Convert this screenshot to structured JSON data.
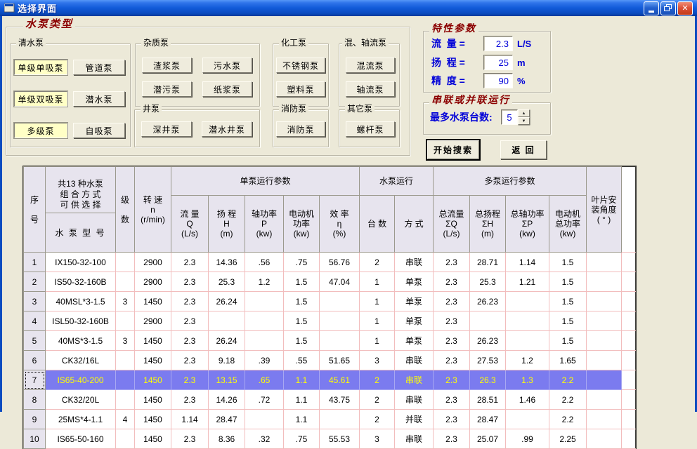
{
  "window": {
    "title": "选择界面",
    "caption_buttons": {
      "minimize": "minimize",
      "restore": "restore",
      "close": "close"
    }
  },
  "colors": {
    "titlebar_blue": "#115ad8",
    "form_background": "#ECE9D8",
    "group_title_red": "#8B0000",
    "label_blue": "#0000D8",
    "highlight_yellow": "#FFFFC6",
    "selection_bg": "#7B7BEF",
    "selection_text": "#FFFF00",
    "grid_line_pink": "#F2BDBD",
    "fixed_cell_bg": "#E7E4EE"
  },
  "pump_types": {
    "group_title": "水泵类型",
    "qingshui": {
      "label": "清水泵",
      "selected_buttons": [
        "单级单吸泵",
        "单级双吸泵",
        "多级泵"
      ],
      "normal_buttons": [
        "管道泵",
        "潜水泵",
        "自吸泵"
      ]
    },
    "zazhi": {
      "label": "杂质泵",
      "buttons": [
        "渣浆泵",
        "污水泵",
        "潜污泵",
        "纸浆泵"
      ]
    },
    "jing": {
      "label": "井泵",
      "buttons": [
        "深井泵",
        "潜水井泵"
      ]
    },
    "huagong": {
      "label": "化工泵",
      "buttons": [
        "不锈钢泵",
        "塑料泵"
      ]
    },
    "xiaofang": {
      "label": "消防泵",
      "buttons": [
        "消防泵"
      ]
    },
    "hunzhou": {
      "label": "混、轴流泵",
      "buttons": [
        "混流泵",
        "轴流泵"
      ]
    },
    "qita": {
      "label": "其它泵",
      "buttons": [
        "螺杆泵"
      ]
    }
  },
  "parameters": {
    "group_title": "特性参数",
    "flow_label": "流  量 =",
    "flow_value": "2.3",
    "flow_unit": "L/S",
    "head_label": "扬  程 =",
    "head_value": "25",
    "head_unit": "m",
    "precision_label": "精  度 =",
    "precision_value": "90",
    "precision_unit": "%"
  },
  "series_parallel": {
    "group_title": "串联或并联运行",
    "max_pumps_label": "最多水泵台数:",
    "max_pumps_value": "5",
    "spin_up": "▲",
    "spin_down": "▼"
  },
  "actions": {
    "search": "开始搜索",
    "back": "返  回"
  },
  "table": {
    "selected_row": 7,
    "header": {
      "seq": "序\n\n号",
      "combo_top": "共13 种水泵\n组 合 方 式\n可 供 选 择",
      "combo_bottom": "水 泵 型 号",
      "stages": "级\n\n数",
      "speed": "转  速\nn\n(r/min)",
      "single_group": "单泵运行参数",
      "run_group": "水泵运行",
      "multi_group": "多泵运行参数",
      "blade": "叶片安\n装角度\n( ° )",
      "single_cols": [
        "流 量\nQ\n(L/s)",
        "扬 程\nH\n(m)",
        "轴功率\nP\n(kw)",
        "电动机\n功率\n(kw)",
        "效 率\nη\n(%)"
      ],
      "run_cols": [
        "台  数",
        "方  式"
      ],
      "multi_cols": [
        "总流量\nΣQ\n(L/s)",
        "总扬程\nΣH\n(m)",
        "总轴功率\nΣP\n(kw)",
        "电动机\n总功率\n(kw)"
      ]
    },
    "rows": [
      [
        "1",
        "IX150-32-100",
        "",
        "2900",
        "2.3",
        "14.36",
        ".56",
        ".75",
        "56.76",
        "2",
        "串联",
        "2.3",
        "28.71",
        "1.14",
        "1.5",
        ""
      ],
      [
        "2",
        "IS50-32-160B",
        "",
        "2900",
        "2.3",
        "25.3",
        "1.2",
        "1.5",
        "47.04",
        "1",
        "单泵",
        "2.3",
        "25.3",
        "1.21",
        "1.5",
        ""
      ],
      [
        "3",
        "40MSL*3-1.5",
        "3",
        "1450",
        "2.3",
        "26.24",
        "",
        "1.5",
        "",
        "1",
        "单泵",
        "2.3",
        "26.23",
        "",
        "1.5",
        ""
      ],
      [
        "4",
        "ISL50-32-160B",
        "",
        "2900",
        "2.3",
        "",
        "",
        "1.5",
        "",
        "1",
        "单泵",
        "2.3",
        "",
        "",
        "1.5",
        ""
      ],
      [
        "5",
        "40MS*3-1.5",
        "3",
        "1450",
        "2.3",
        "26.24",
        "",
        "1.5",
        "",
        "1",
        "单泵",
        "2.3",
        "26.23",
        "",
        "1.5",
        ""
      ],
      [
        "6",
        "CK32/16L",
        "",
        "1450",
        "2.3",
        "9.18",
        ".39",
        ".55",
        "51.65",
        "3",
        "串联",
        "2.3",
        "27.53",
        "1.2",
        "1.65",
        ""
      ],
      [
        "7",
        "IS65-40-200",
        "",
        "1450",
        "2.3",
        "13.15",
        ".65",
        "1.1",
        "45.61",
        "2",
        "串联",
        "2.3",
        "26.3",
        "1.3",
        "2.2",
        ""
      ],
      [
        "8",
        "CK32/20L",
        "",
        "1450",
        "2.3",
        "14.26",
        ".72",
        "1.1",
        "43.75",
        "2",
        "串联",
        "2.3",
        "28.51",
        "1.46",
        "2.2",
        ""
      ],
      [
        "9",
        "25MS*4-1.1",
        "4",
        "1450",
        "1.14",
        "28.47",
        "",
        "1.1",
        "",
        "2",
        "并联",
        "2.3",
        "28.47",
        "",
        "2.2",
        ""
      ],
      [
        "10",
        "IS65-50-160",
        "",
        "1450",
        "2.3",
        "8.36",
        ".32",
        ".75",
        "55.53",
        "3",
        "串联",
        "2.3",
        "25.07",
        ".99",
        "2.25",
        ""
      ]
    ]
  }
}
